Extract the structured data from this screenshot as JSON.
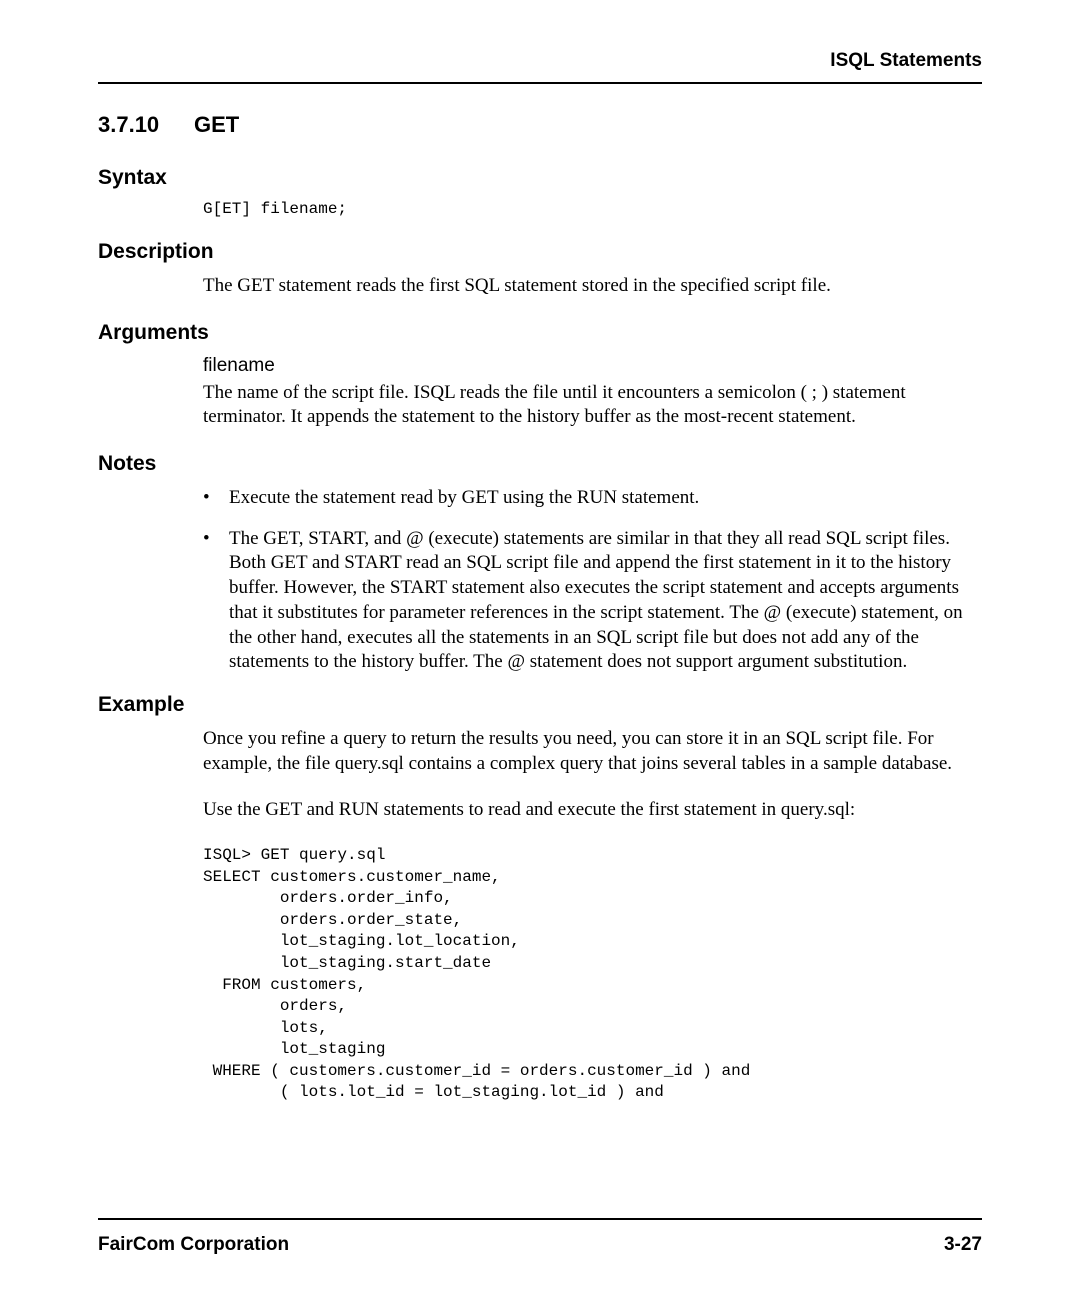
{
  "header": {
    "running_title": "ISQL Statements"
  },
  "section": {
    "number": "3.7.10",
    "title": "GET"
  },
  "syntax": {
    "heading": "Syntax",
    "code": "G[ET] filename;"
  },
  "description": {
    "heading": "Description",
    "text": "The GET statement reads the first SQL statement stored in the specified script file."
  },
  "arguments": {
    "heading": "Arguments",
    "items": [
      {
        "name": "filename",
        "desc": "The name of the script file. ISQL reads the file until it encounters a semicolon ( ; ) statement terminator. It appends the statement to the history buffer as the most-recent statement."
      }
    ]
  },
  "notes": {
    "heading": "Notes",
    "items": [
      "Execute the statement read by GET using the RUN statement.",
      "The GET, START, and @ (execute) statements are similar in that they all read SQL script files. Both GET and START read an SQL script file and append the first statement in it to the history buffer. However, the START statement also executes the script statement and accepts arguments that it substitutes for parameter references in the script statement. The @ (execute) statement, on the other hand, executes all the statements in an SQL script file but does not add any of the statements to the history buffer. The @ statement does not support argument substitution."
    ]
  },
  "example": {
    "heading": "Example",
    "para1": "Once you refine a query to return the results you need, you can store it in an SQL  script file. For example, the file query.sql  contains a complex query that joins several tables in a sample database.",
    "para2": "Use the GET and RUN statements to read and execute the first statement in query.sql:",
    "code": "ISQL> GET query.sql\nSELECT customers.customer_name,\n        orders.order_info,\n        orders.order_state,\n        lot_staging.lot_location,\n        lot_staging.start_date\n  FROM customers,\n        orders,\n        lots,\n        lot_staging\n WHERE ( customers.customer_id = orders.customer_id ) and\n        ( lots.lot_id = lot_staging.lot_id ) and"
  },
  "footer": {
    "left": "FairCom Corporation",
    "right": "3-27"
  }
}
